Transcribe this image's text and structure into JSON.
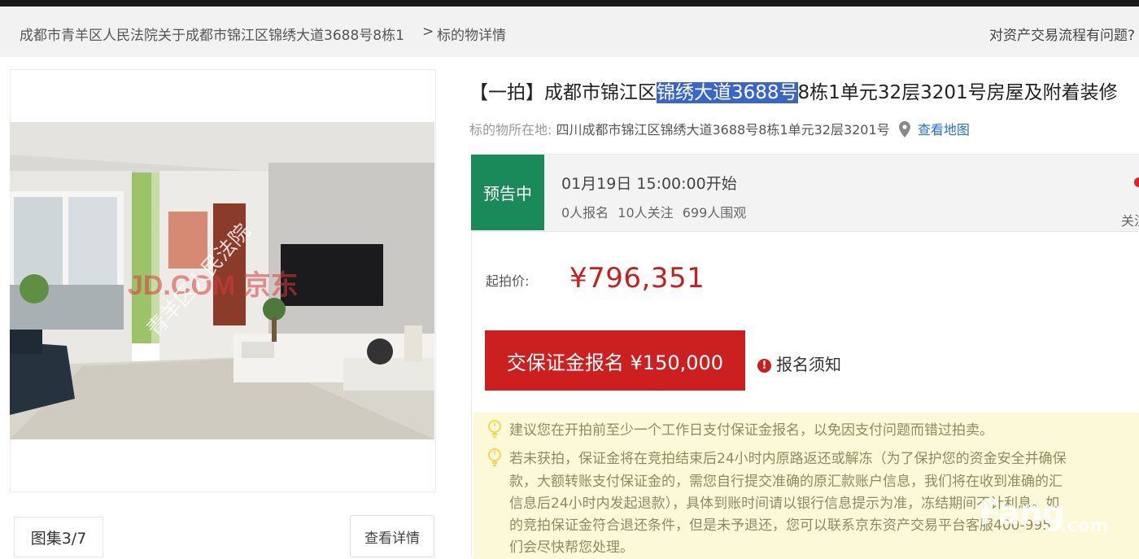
{
  "breadcrumb": {
    "items": [
      "成都市青羊区人民法院关于成都市锦江区锦绣大道3688号8栋1",
      "标的物详情"
    ],
    "separator": ">",
    "help_text": "对资产交易流程有问题?"
  },
  "gallery": {
    "counter": "图集3/7",
    "details_label": "查看详情",
    "watermark_court": "青羊区人民法院",
    "watermark_brand": "JD.COM 京东"
  },
  "listing": {
    "title_prefix": "【一拍】成都市锦江区",
    "title_highlight": "锦绣大道3688号",
    "title_suffix": "8栋1单元32层3201号房屋及附着装修",
    "location_label": "标的物所在地:",
    "location_value": "四川成都市锦江区锦绣大道3688号8栋1单元32层3201号",
    "map_link": "查看地图"
  },
  "status": {
    "badge": "预告中",
    "start_time": "01月19日 15:00:00开始",
    "signups": "0人报名",
    "followers": "10人关注",
    "views": "699人围观",
    "follow_label": "关注"
  },
  "price": {
    "label": "起拍价:",
    "value": "¥796,351"
  },
  "actions": {
    "deposit_button": "交保证金报名 ¥150,000",
    "notice_link": "报名须知"
  },
  "tips": {
    "tip1": "建议您在开拍前至少一个工作日支付保证金报名，以免因支付问题而错过拍卖。",
    "tip2_lines": [
      "若未获拍，保证金将在竞拍结束后24小时内原路返还或解冻（为了保护您的资金安全并确保",
      "款，大额转账支付保证金的，需您自行提交准确的原汇款账户信息，我们将在收到准确的汇",
      "信息后24小时内发起退款），具体到账时间请以银行信息提示为准，冻结期间不计利息。如",
      "的竞拍保证金符合退还条件，但是未予退还，您可以联系京东资产交易平台客服400-995",
      "们会尽快帮您处理。"
    ]
  },
  "watermark": {
    "site": "Fang",
    "domain": ".com"
  },
  "colors": {
    "badge_green": "#1b8a5a",
    "price_red": "#c81e1e",
    "button_red": "#cc1f1f",
    "link_blue": "#2a6fd6",
    "tips_bg": "#fbf9d8"
  }
}
